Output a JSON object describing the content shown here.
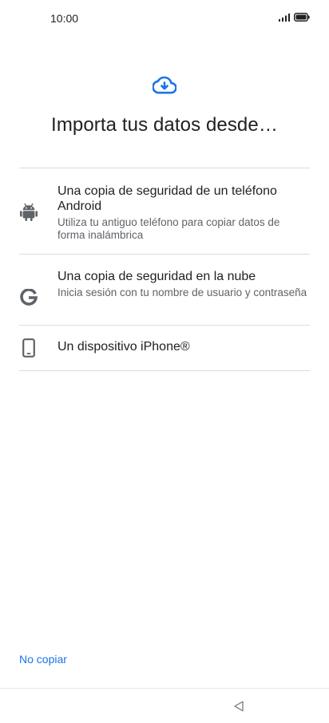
{
  "status_bar": {
    "time": "10:00",
    "icons": [
      "signal-icon",
      "battery-icon"
    ]
  },
  "header": {
    "icon": "cloud-download-icon",
    "title": "Importa tus datos desde…"
  },
  "options": [
    {
      "icon": "android-icon",
      "title": "Una copia de seguridad de un teléfono Android",
      "subtitle": "Utiliza tu antiguo teléfono para copiar datos de forma inalámbrica"
    },
    {
      "icon": "google-icon",
      "title": "Una copia de seguridad en la nube",
      "subtitle": "Inicia sesión con tu nombre de usuario y contraseña"
    },
    {
      "icon": "smartphone-icon",
      "title": "Un dispositivo iPhone®",
      "subtitle": ""
    }
  ],
  "footer": {
    "skip_label": "No copiar"
  },
  "nav_bar": {
    "icons": [
      "back-triangle-icon"
    ]
  },
  "colors": {
    "accent": "#1a73e8",
    "icon_gray": "#5f6368",
    "divider": "#dadce0",
    "text_primary": "#202124",
    "text_secondary": "#5f6368"
  }
}
